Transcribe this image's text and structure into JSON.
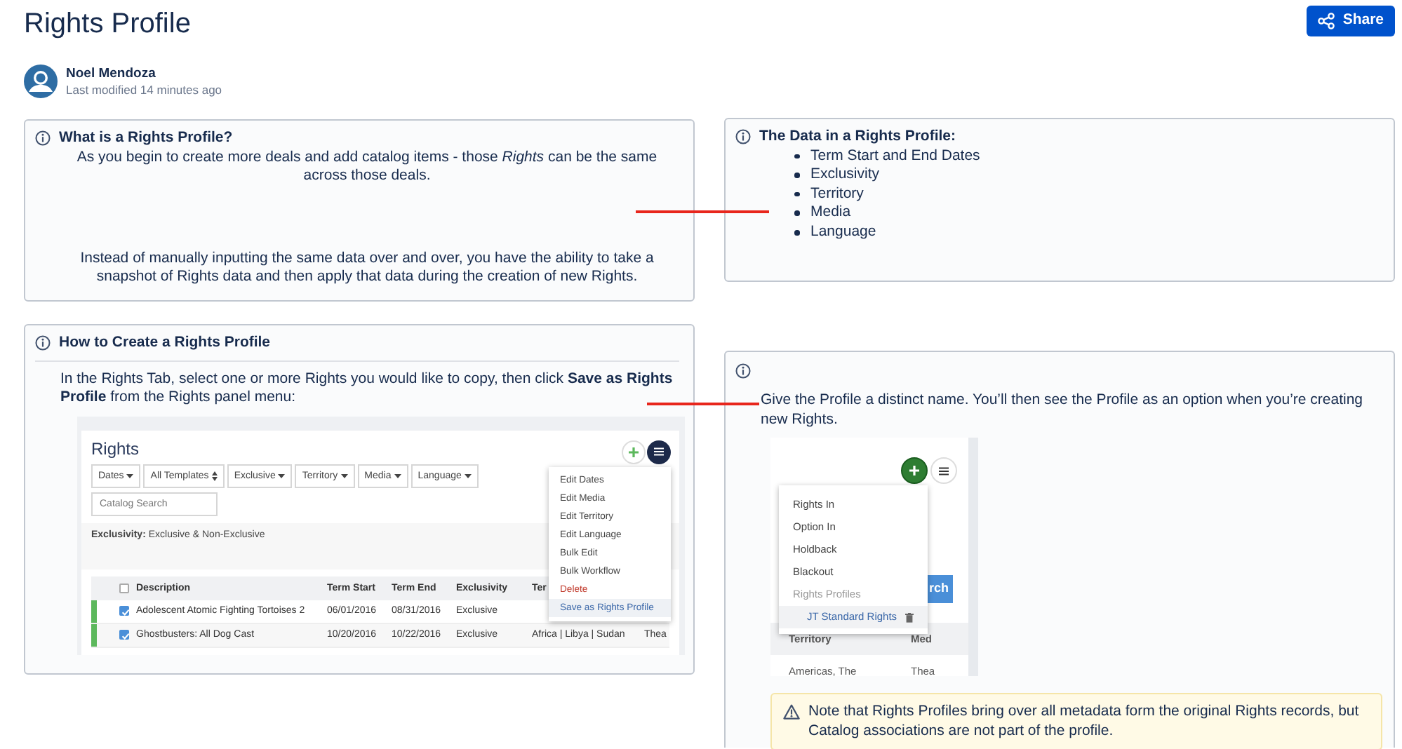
{
  "page": {
    "title": "Rights Profile",
    "share": "Share"
  },
  "author": {
    "name": "Noel Mendoza",
    "modified": "Last modified 14 minutes ago"
  },
  "intro": {
    "title": "What is a Rights Profile?",
    "paragraphs": [
      "As you begin to create more deals and add catalog items - those *Rights* can be the same across those deals.",
      "Instead of manually inputting the same data over and over, you have the ability to take a snapshot of Rights data and then apply that data during the creation of new Rights."
    ]
  },
  "data_panel": {
    "title": "The Data in a Rights Profile:",
    "items": [
      "Term Start and End Dates",
      "Exclusivity",
      "Territory",
      "Media",
      "Language"
    ]
  },
  "how_panel": {
    "title": "How to Create a Rights Profile",
    "text": "In the Rights Tab, select one or more Rights you would like to copy, then click **Save as Rights Profile** from the Rights panel menu:",
    "screenshot": {
      "title": "Rights",
      "filters": [
        {
          "label": "Dates",
          "kind": "dropdown"
        },
        {
          "label": "All Templates",
          "kind": "select"
        },
        {
          "label": "Exclusive",
          "kind": "dropdown"
        },
        {
          "label": "Territory",
          "kind": "dropdown"
        },
        {
          "label": "Media",
          "kind": "dropdown"
        },
        {
          "label": "Language",
          "kind": "dropdown"
        }
      ],
      "search_placeholder": "Catalog Search",
      "summary": "**Exclusivity:** Exclusive & Non-Exclusive",
      "header_checked": false,
      "columns": [
        "Description",
        "Term Start",
        "Term End",
        "Exclusivity",
        "Ter"
      ],
      "rows": [
        {
          "checked": true,
          "cells": [
            "Adolescent Atomic Fighting Tortoises 2",
            "06/01/2016",
            "08/31/2016",
            "Exclusive"
          ]
        },
        {
          "checked": true,
          "cells": [
            "Ghostbusters: All Dog Cast",
            "10/20/2016",
            "10/22/2016",
            "Exclusive",
            "Africa | Libya | Sudan",
            "Thea"
          ]
        }
      ],
      "menu": [
        {
          "label": "Edit Dates",
          "kind": "action",
          "selected": false
        },
        {
          "label": "Edit Media",
          "kind": "action",
          "selected": false
        },
        {
          "label": "Edit Territory",
          "kind": "action",
          "selected": false
        },
        {
          "label": "Edit Language",
          "kind": "action",
          "selected": false
        },
        {
          "label": "Bulk Edit",
          "kind": "action",
          "selected": false
        },
        {
          "label": "Bulk Workflow",
          "kind": "action",
          "selected": false
        },
        {
          "label": "Delete",
          "kind": "danger",
          "selected": false
        },
        {
          "label": "Save as Rights Profile",
          "kind": "action",
          "selected": true
        }
      ]
    }
  },
  "name_panel": {
    "text": "Give the Profile a distinct name. You’ll then see the Profile as an option when you’re creating new Rights.",
    "screenshot": {
      "search_button": "rch",
      "columns": [
        "Territory",
        "Med"
      ],
      "row": [
        "Americas, The",
        "Thea"
      ],
      "menu": [
        {
          "label": "Rights In",
          "kind": "action",
          "selected": false
        },
        {
          "label": "Option In",
          "kind": "action",
          "selected": false
        },
        {
          "label": "Holdback",
          "kind": "action",
          "selected": false
        },
        {
          "label": "Blackout",
          "kind": "action",
          "selected": false
        },
        {
          "label": "Rights Profiles",
          "kind": "header",
          "selected": false
        },
        {
          "label": "JT Standard Rights",
          "kind": "profile",
          "selected": true
        }
      ]
    },
    "note": "Note that Rights Profiles bring over all metadata form the original Rights records, but Catalog associations are not part of the profile."
  }
}
